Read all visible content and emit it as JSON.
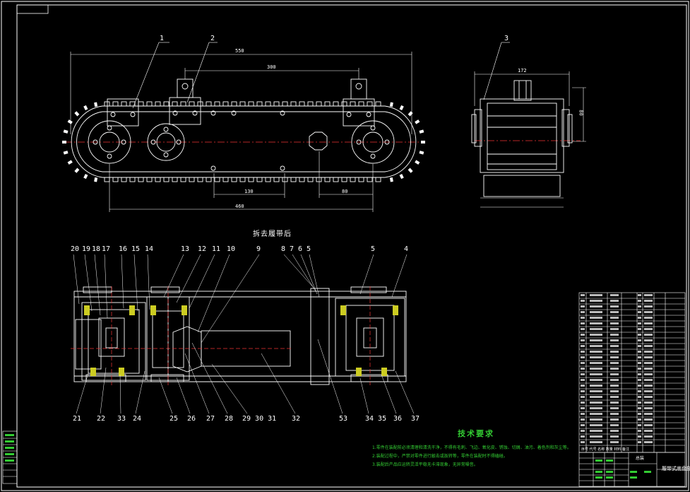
{
  "top_view": {
    "dims": {
      "overall": "550",
      "spacing": "300",
      "lower_left": "130",
      "lower_right": "80",
      "bottom": "460"
    },
    "callouts": [
      "1",
      "2"
    ]
  },
  "side_view": {
    "dims": {
      "width": "172",
      "height": "80"
    },
    "callouts": [
      "3"
    ]
  },
  "section": {
    "title": "拆去履带后",
    "top_callouts": [
      "20",
      "19",
      "18",
      "17",
      "16",
      "15",
      "14",
      "13",
      "12",
      "11",
      "10",
      "9",
      "8",
      "7",
      "6",
      "5",
      "5",
      "4"
    ],
    "bottom_callouts": [
      "21",
      "22",
      "33",
      "24",
      "25",
      "26",
      "27",
      "28",
      "29 30 31",
      "32",
      "53",
      "34 35",
      "36",
      "37"
    ]
  },
  "tech": {
    "title": "技术要求",
    "lines": [
      "1.零件在装配前必须清理和清洗干净，不得有毛刺、飞边、氧化皮、锈蚀、切屑、油污、着色剂和灰尘等。",
      "2.装配过程中，严禁对零件进行敲击或扳转等，零件在装配时不得磕碰。",
      "3.装配后产品应运转灵活平稳无卡滞现象，无异常噪音。"
    ]
  },
  "title_block": {
    "name": "履带式底盘部分",
    "header_row": [
      "序号",
      "代号",
      "名称",
      "数量",
      "材料",
      "备注"
    ],
    "label": "总装"
  }
}
